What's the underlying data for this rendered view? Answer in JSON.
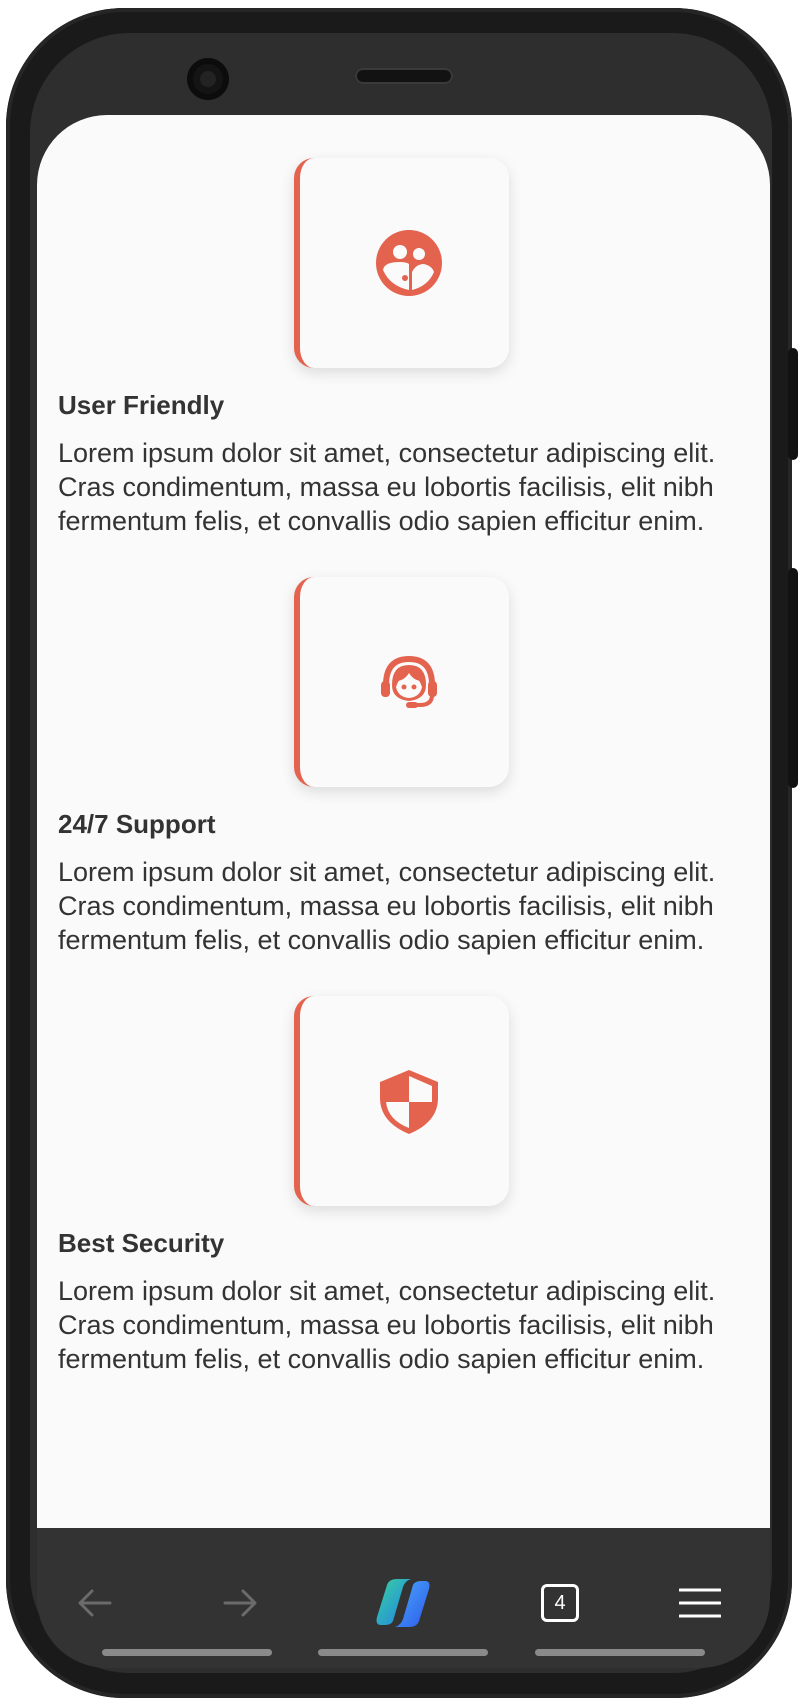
{
  "features": [
    {
      "title": "User Friendly",
      "description": "Lorem ipsum dolor sit amet, consectetur adipiscing elit. Cras condimentum, massa eu lobortis facilisis, elit nibh fermentum felis, et convallis odio sapien efficitur enim.",
      "icon": "user-friendly-icon"
    },
    {
      "title": "24/7 Support",
      "description": "Lorem ipsum dolor sit amet, consectetur adipiscing elit. Cras condimentum, massa eu lobortis facilisis, elit nibh fermentum felis, et convallis odio sapien efficitur enim.",
      "icon": "headset-support-icon"
    },
    {
      "title": "Best Security",
      "description": "Lorem ipsum dolor sit amet, consectetur adipiscing elit. Cras condimentum, massa eu lobortis facilisis, elit nibh fermentum felis, et convallis odio sapien efficitur enim.",
      "icon": "shield-icon"
    }
  ],
  "browser_nav": {
    "back_icon": "arrow-left-icon",
    "forward_icon": "arrow-right-icon",
    "copilot_icon": "copilot-icon",
    "tab_count": "4",
    "menu_icon": "hamburger-menu-icon"
  },
  "colors": {
    "accent": "#e4634e",
    "text": "#333333",
    "screen_bg": "#fafafa",
    "nav_bg": "#333333"
  }
}
